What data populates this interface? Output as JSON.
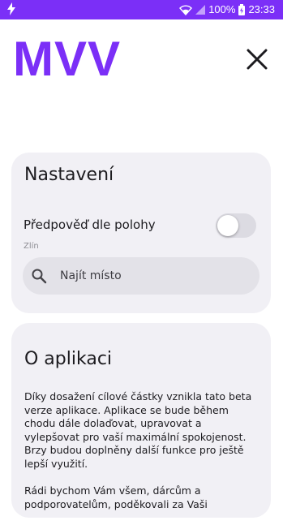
{
  "status_bar": {
    "battery": "100%",
    "time": "23:33",
    "background_color": "#7b2ff7"
  },
  "header": {
    "logo": "MVV",
    "logo_color": "#7b2ff7",
    "close_icon": "close-icon"
  },
  "settings": {
    "title": "Nastavení",
    "location_forecast_label": "Předpověď dle polohy",
    "location_forecast_enabled": false,
    "current_location": "Zlín",
    "search": {
      "value": "",
      "placeholder": "Najít místo",
      "icon": "search-icon"
    }
  },
  "about": {
    "title": "O aplikaci",
    "paragraph_1": "Díky dosažení cílové částky vznikla tato beta verze aplikace. Aplikace se bude během chodu dále dolaďovat, upravovat a vylepšovat pro vaší maximální spokojenost. Brzy budou doplněny další funkce pro ještě lepší využití.",
    "paragraph_2": "Rádi bychom Vám všem, dárcům a podporovatelům, poděkovali za Vaši"
  }
}
